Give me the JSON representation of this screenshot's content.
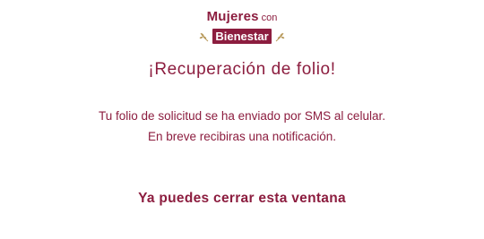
{
  "logo": {
    "brand": "Mujeres",
    "connector": "con",
    "badge": "Bienestar",
    "brand_color": "#8c1d3f",
    "accent_color": "#b89a5c"
  },
  "title": "¡Recuperación de folio!",
  "message": {
    "line1": "Tu folio de solicitud se ha enviado por SMS al celular.",
    "line2": "En breve recibiras una notificación."
  },
  "closing": "Ya puedes cerrar esta ventana"
}
